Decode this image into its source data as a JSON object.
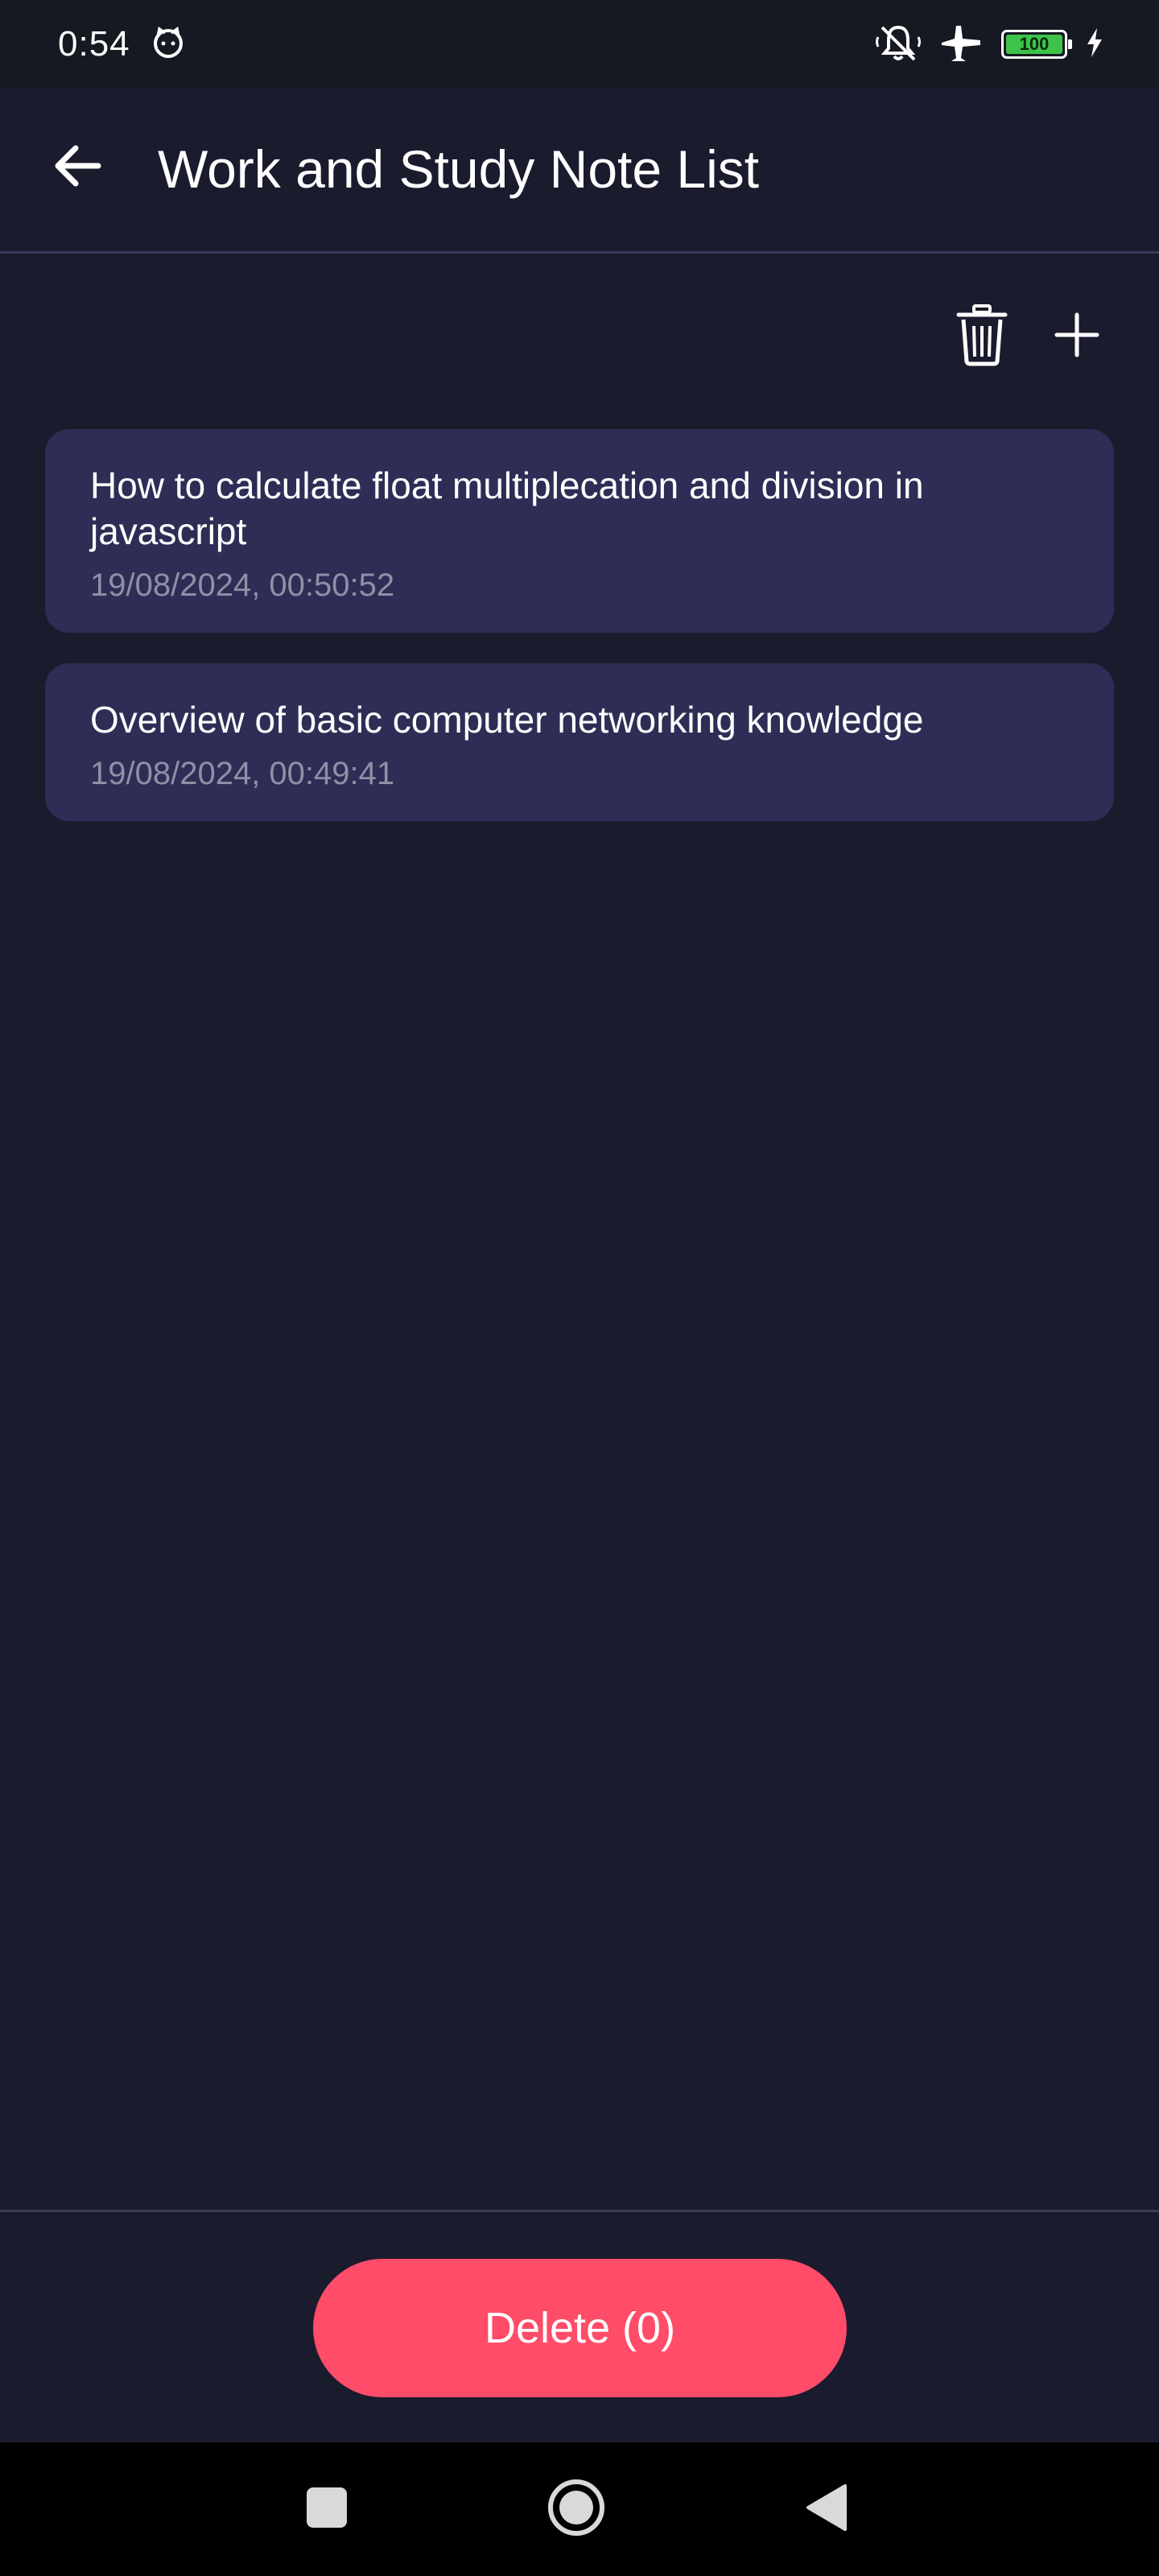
{
  "status_bar": {
    "time": "0:54",
    "battery_level": "100",
    "icons": [
      "cat-face-icon",
      "bell-off-icon",
      "airplane-icon",
      "battery-icon",
      "charging-bolt-icon"
    ],
    "battery_color": "#3dc34a"
  },
  "header": {
    "title": "Work and Study Note List",
    "back_icon": "back-arrow-icon"
  },
  "toolbar": {
    "actions": [
      "trash-icon",
      "plus-icon"
    ]
  },
  "notes": [
    {
      "title": "How to calculate float multiplecation and division in javascript",
      "timestamp": "19/08/2024, 00:50:52"
    },
    {
      "title": "Overview of basic computer networking knowledge",
      "timestamp": "19/08/2024, 00:49:41"
    }
  ],
  "footer": {
    "delete_label": "Delete (0)",
    "delete_color": "#ff4c69"
  },
  "navigation": {
    "buttons": [
      "recents-square-icon",
      "home-circle-icon",
      "back-triangle-icon"
    ]
  },
  "colors": {
    "background": "#1b1b2e",
    "card": "#2e2d55",
    "muted_text": "#8f8fa6"
  }
}
